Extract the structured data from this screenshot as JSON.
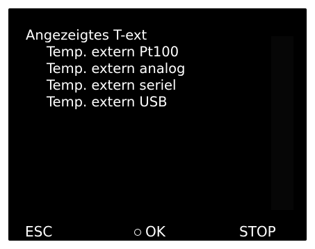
{
  "menu": {
    "title": "Angezeigtes T-ext",
    "items": [
      {
        "label": "Temp. extern Pt100"
      },
      {
        "label": "Temp. extern analog"
      },
      {
        "label": "Temp. extern seriel"
      },
      {
        "label": "Temp. extern USB"
      }
    ]
  },
  "softkeys": {
    "esc": "ESC",
    "ok": "OK",
    "ok_icon": "circle-icon",
    "stop": "STOP"
  },
  "colors": {
    "background": "#000000",
    "text": "#ffffff"
  }
}
